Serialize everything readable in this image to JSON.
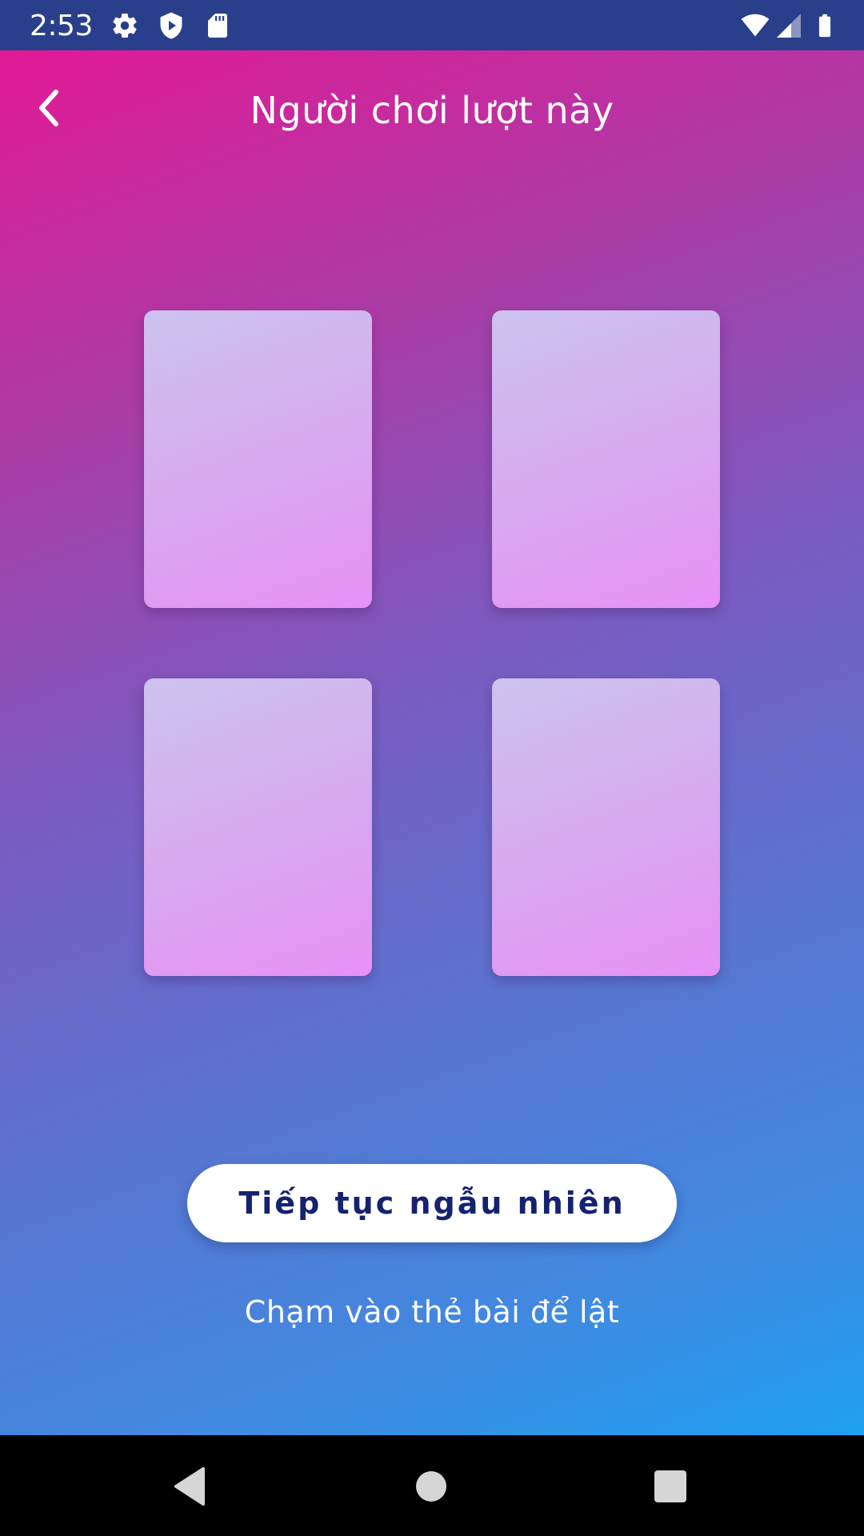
{
  "status_bar": {
    "time": "2:53",
    "icons": [
      "gear-icon",
      "shield-play-icon",
      "sd-card-icon",
      "wifi-icon",
      "cell-signal-icon",
      "battery-icon"
    ]
  },
  "header": {
    "back_icon": "chevron-left-icon",
    "title": "Người chơi lượt này"
  },
  "cards": [
    {
      "state": "face-down"
    },
    {
      "state": "face-down"
    },
    {
      "state": "face-down"
    },
    {
      "state": "face-down"
    }
  ],
  "actions": {
    "continue_label": "Tiếp tục ngẫu nhiên"
  },
  "hint": "Chạm vào thẻ bài để lật",
  "nav_bar": {
    "icons": [
      "back-triangle-icon",
      "home-circle-icon",
      "recents-square-icon"
    ]
  },
  "colors": {
    "status_bar": "#2a3f8c",
    "gradient_start": "#e21a96",
    "gradient_end": "#1ea0f0",
    "card_start": "#cbc3ee",
    "card_end": "#e890f6",
    "button_text": "#142270"
  }
}
